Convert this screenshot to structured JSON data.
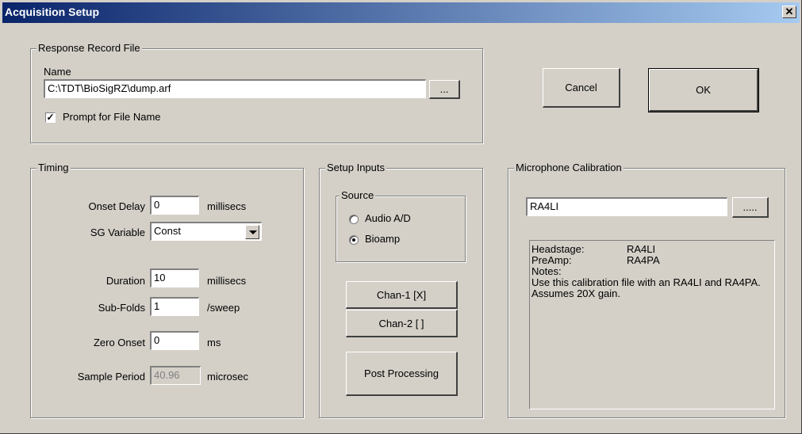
{
  "window": {
    "title": "Acquisition Setup",
    "close_glyph": "✕"
  },
  "response_file": {
    "legend": "Response Record File",
    "name_label": "Name",
    "path": "C:\\TDT\\BioSigRZ\\dump.arf",
    "browse_label": "...",
    "prompt_label": "Prompt for File Name",
    "prompt_checked": true,
    "check_glyph": "✓"
  },
  "buttons": {
    "cancel": "Cancel",
    "ok": "OK"
  },
  "timing": {
    "legend": "Timing",
    "onset_delay": {
      "label": "Onset Delay",
      "value": "0",
      "unit": "millisecs"
    },
    "sg_variable": {
      "label": "SG Variable",
      "value": "Const"
    },
    "duration": {
      "label": "Duration",
      "value": "10",
      "unit": "millisecs"
    },
    "sub_folds": {
      "label": "Sub-Folds",
      "value": "1",
      "unit": "/sweep"
    },
    "zero_onset": {
      "label": "Zero Onset",
      "value": "0",
      "unit": "ms"
    },
    "sample_period": {
      "label": "Sample Period",
      "value": "40.96",
      "unit": "microsec"
    }
  },
  "setup_inputs": {
    "legend": "Setup Inputs",
    "source_legend": "Source",
    "audio_label": "Audio A/D",
    "bioamp_label": "Bioamp",
    "selected": "Bioamp",
    "chan1": "Chan-1  [X]",
    "chan2": "Chan-2  [  ]",
    "post_processing": "Post Processing"
  },
  "calibration": {
    "legend": "Microphone Calibration",
    "file": "RA4LI",
    "browse_label": ".....",
    "headstage_key": "Headstage:",
    "headstage_val": "RA4LI",
    "preamp_key": "PreAmp:",
    "preamp_val": "RA4PA",
    "notes_key": "Notes:",
    "notes_text": "Use this calibration file with an RA4LI and RA4PA. Assumes 20X gain."
  }
}
